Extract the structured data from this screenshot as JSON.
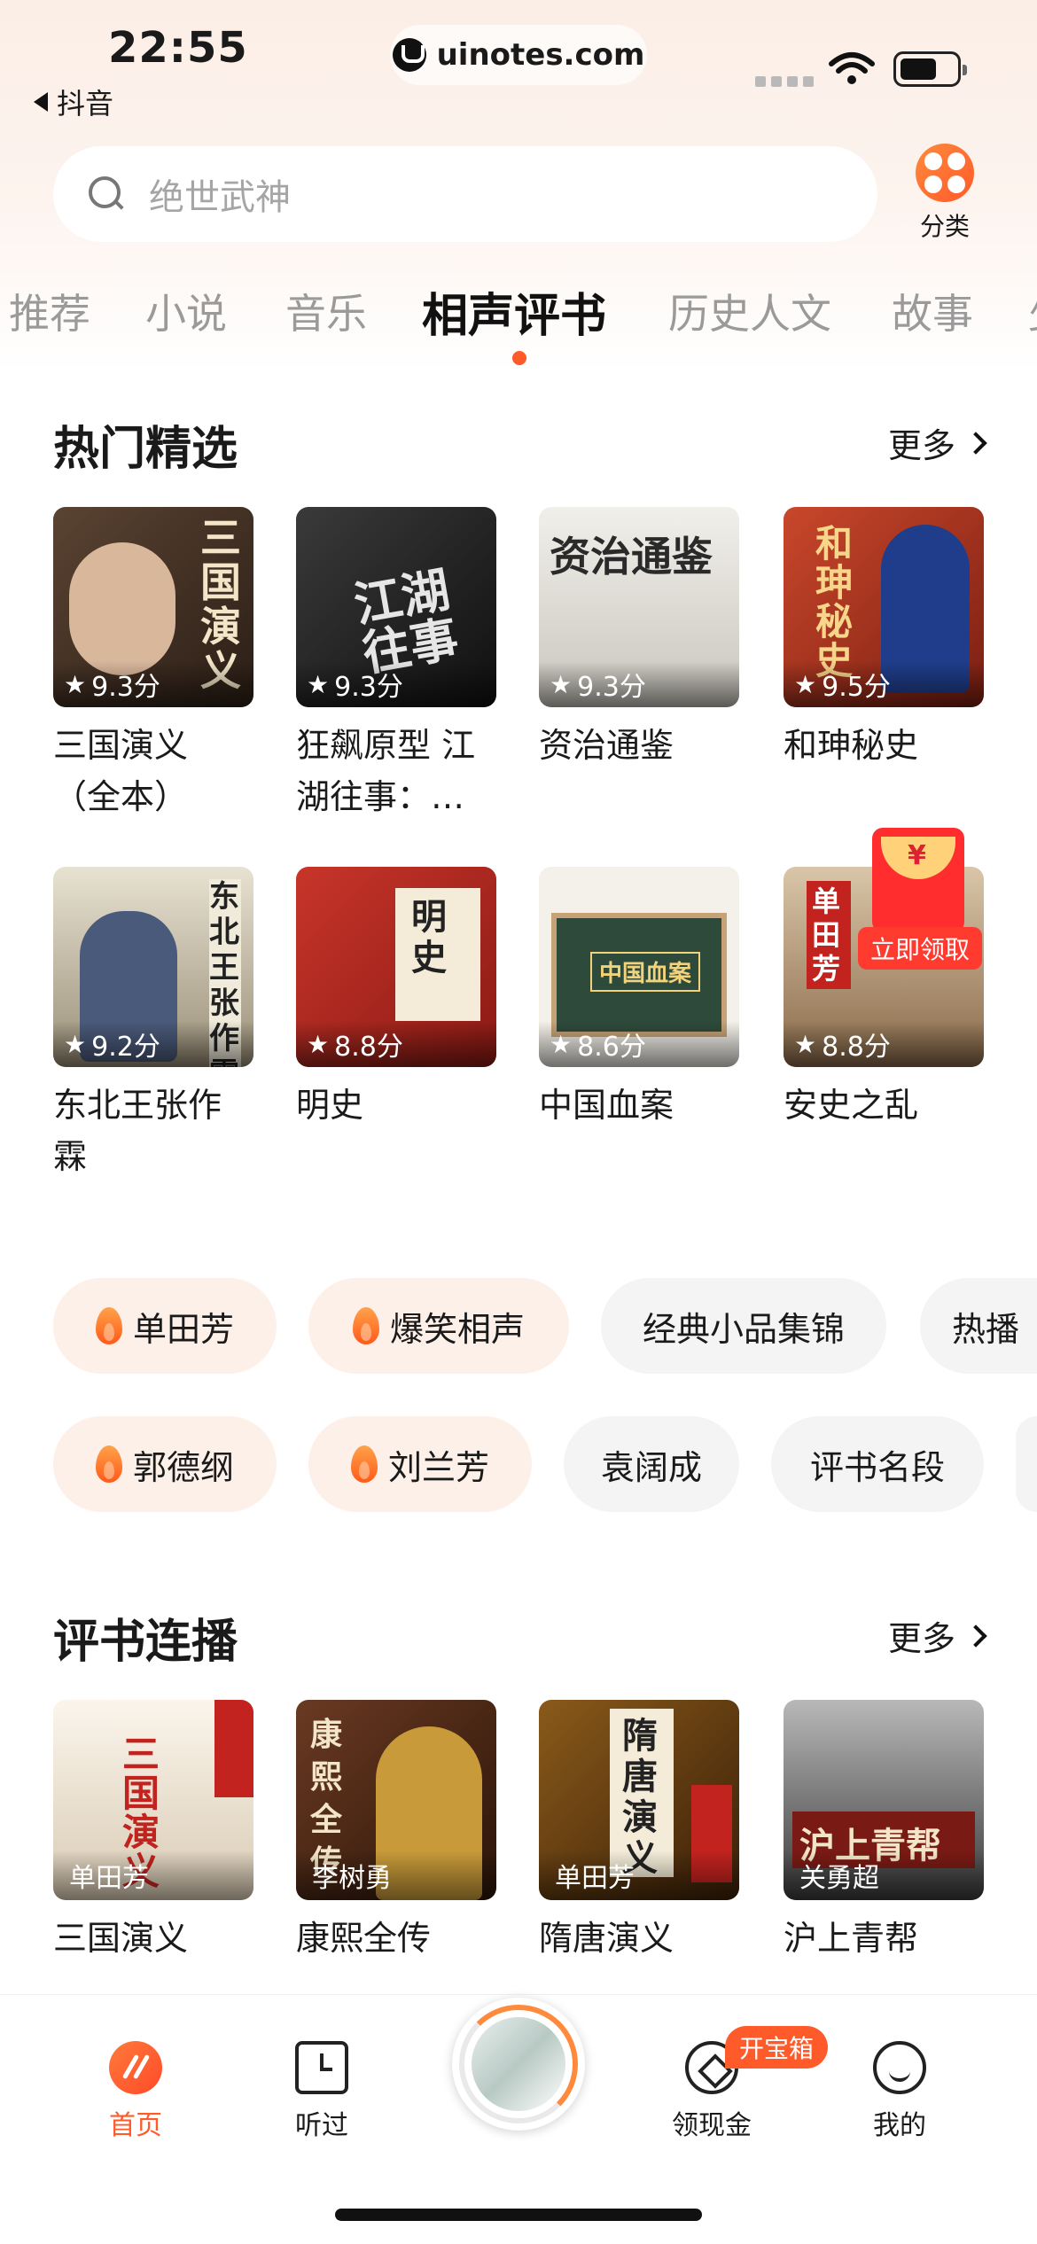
{
  "status_bar": {
    "time": "22:55",
    "back_app": "抖音",
    "url": "uinotes.com"
  },
  "search": {
    "placeholder": "绝世武神"
  },
  "category": {
    "label": "分类"
  },
  "tabs": [
    "推荐",
    "小说",
    "音乐",
    "相声评书",
    "历史人文",
    "故事",
    "少"
  ],
  "active_tab": "相声评书",
  "hot": {
    "title": "热门精选",
    "more": "更多",
    "items": [
      {
        "name": "三国演义（全本）",
        "rating": "9.3分",
        "cover_text": "三国演义"
      },
      {
        "name": "狂飙原型 江湖往事：…",
        "rating": "9.3分",
        "cover_text": "江湖往事"
      },
      {
        "name": "资治通鉴",
        "rating": "9.3分",
        "cover_text": "资治通鉴"
      },
      {
        "name": "和珅秘史",
        "rating": "9.5分",
        "cover_text": "和珅秘史"
      },
      {
        "name": "东北王张作霖",
        "rating": "9.2分",
        "cover_text": "东北王张作霖"
      },
      {
        "name": "明史",
        "rating": "8.8分",
        "cover_text": "明史"
      },
      {
        "name": "中国血案",
        "rating": "8.6分",
        "cover_text": "中国血案"
      },
      {
        "name": "安史之乱",
        "rating": "8.8分",
        "cover_text": "单田芳"
      }
    ]
  },
  "promo": {
    "claim_label": "立即领取",
    "yen": "¥"
  },
  "chips_row1": [
    {
      "label": "单田芳",
      "hot": true
    },
    {
      "label": "爆笑相声",
      "hot": true
    },
    {
      "label": "经典小品集锦",
      "hot": false
    },
    {
      "label": "热播",
      "hot": false
    }
  ],
  "chips_row2": [
    {
      "label": "郭德纲",
      "hot": true
    },
    {
      "label": "刘兰芳",
      "hot": true
    },
    {
      "label": "袁阔成",
      "hot": false
    },
    {
      "label": "评书名段",
      "hot": false
    }
  ],
  "serial": {
    "title": "评书连播",
    "more": "更多",
    "items": [
      {
        "name": "三国演义",
        "reader": "单田芳",
        "cover_text": "三国演义"
      },
      {
        "name": "康熙全传",
        "reader": "李树勇",
        "cover_text": "康熙全传"
      },
      {
        "name": "隋唐演义",
        "reader": "单田芳",
        "cover_text": "隋唐演义"
      },
      {
        "name": "沪上青帮",
        "reader": "关勇超",
        "cover_text": "沪上青帮"
      }
    ]
  },
  "bottom_nav": {
    "home": "首页",
    "history": "听过",
    "cash": "领现金",
    "cash_badge": "开宝箱",
    "me": "我的"
  },
  "colors": {
    "accent": "#ff5a2a",
    "chip_hot_bg": "#fdf0e8"
  }
}
